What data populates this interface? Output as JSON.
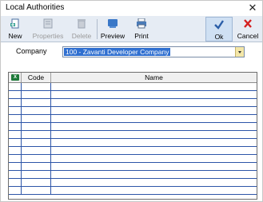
{
  "window": {
    "title": "Local Authorities",
    "close_glyph": "✕"
  },
  "toolbar": {
    "buttons": [
      {
        "label": "New",
        "icon": "new-document-icon",
        "enabled": true
      },
      {
        "label": "Properties",
        "icon": "properties-icon",
        "enabled": false
      },
      {
        "label": "Delete",
        "icon": "trash-icon",
        "enabled": false
      },
      {
        "label": "Preview",
        "icon": "preview-icon",
        "enabled": true
      },
      {
        "label": "Print",
        "icon": "printer-icon",
        "enabled": true
      },
      {
        "label": "Ok",
        "icon": "checkmark-icon",
        "enabled": true
      },
      {
        "label": "Cancel",
        "icon": "cancel-x-icon",
        "enabled": true
      }
    ]
  },
  "company": {
    "label": "Company",
    "value": "100 - Zavanti Developer Company"
  },
  "grid": {
    "columns": {
      "excel": "X",
      "code": "Code",
      "name": "Name"
    },
    "empty_row_count": 14
  },
  "colors": {
    "toolbar_bg": "#e6ecf4",
    "selection": "#2f6fd0",
    "grid_lines": "#2d55a8",
    "excel_green": "#1f7a3a",
    "cancel_red": "#d42020",
    "ok_blue": "#2a5ea8"
  }
}
